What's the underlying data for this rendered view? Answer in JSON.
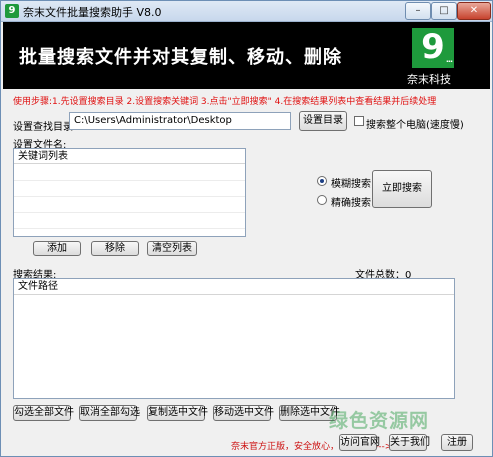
{
  "window": {
    "title": "奈末文件批量搜索助手 V8.0",
    "icon_glyph": "9",
    "controls": {
      "minimize_glyph": "–",
      "maximize_glyph": "□",
      "close_glyph": "✕"
    }
  },
  "banner": {
    "heading": "批量搜索文件并对其复制、移动、删除",
    "logo_glyph": "9",
    "logo_dots": "...",
    "logo_name": "奈末科技",
    "logo_color": "#1e9a3c"
  },
  "instructions": "使用步骤:1.先设置搜索目录 2.设置搜索关键词 3.点击\"立即搜索\" 4.在搜索结果列表中查看结果并后续处理",
  "search_dir": {
    "label": "设置查找目录:",
    "value": "C:\\Users\\Administrator\\Desktop",
    "set_button": "设置目录",
    "whole_pc_checkbox_label": "搜索整个电脑(速度慢)",
    "whole_pc_checked": false
  },
  "filename_section": {
    "label": "设置文件名:",
    "column_header": "关键词列表",
    "add_button": "添加",
    "remove_button": "移除",
    "clear_button": "清空列表"
  },
  "mode": {
    "fuzzy_label": "模糊搜索",
    "exact_label": "精确搜索",
    "selected": "fuzzy",
    "search_button": "立即搜索"
  },
  "results": {
    "label": "搜索结果:",
    "count_label": "文件总数：0",
    "column_header": "文件路径"
  },
  "actions": {
    "select_all": "勾选全部文件",
    "deselect_all": "取消全部勾选",
    "copy": "复制选中文件",
    "move": "移动选中文件",
    "delete": "删除选中文件"
  },
  "footer": {
    "note": "奈末官方正版，安全放心，官方下载--->",
    "website_button": "访问官网",
    "about_button": "关于我们",
    "register_button": "注册"
  },
  "watermark": "绿色资源网",
  "colors": {
    "accent_red": "#e01010",
    "brand_green": "#1e9a3c",
    "banner_bg": "#000000"
  }
}
